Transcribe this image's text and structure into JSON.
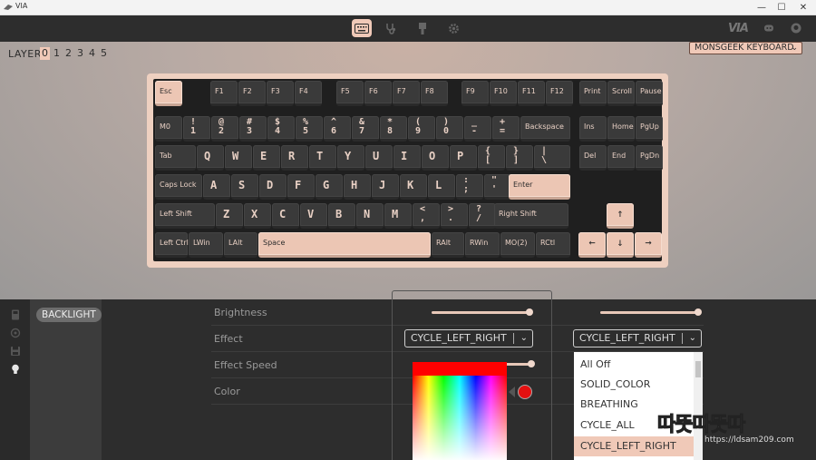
{
  "window": {
    "title": "VIA"
  },
  "layers": {
    "label": "LAYER",
    "items": [
      "0",
      "1",
      "2",
      "3",
      "4",
      "5"
    ],
    "active": 0
  },
  "keyboard_select": {
    "value": "MONSGEEK KEYBOARD"
  },
  "brand": "VIA",
  "keys": {
    "esc": "Esc",
    "f1": "F1",
    "f2": "F2",
    "f3": "F3",
    "f4": "F4",
    "f5": "F5",
    "f6": "F6",
    "f7": "F7",
    "f8": "F8",
    "f9": "F9",
    "f10": "F10",
    "f11": "F11",
    "f12": "F12",
    "print": "Print",
    "scroll": "Scroll",
    "pause": "Pause",
    "m0": "M0",
    "n1_top": "!",
    "n1_bot": "1",
    "n2_top": "@",
    "n2_bot": "2",
    "n3_top": "#",
    "n3_bot": "3",
    "n4_top": "$",
    "n4_bot": "4",
    "n5_top": "%",
    "n5_bot": "5",
    "n6_top": "^",
    "n6_bot": "6",
    "n7_top": "&",
    "n7_bot": "7",
    "n8_top": "*",
    "n8_bot": "8",
    "n9_top": "(",
    "n9_bot": "9",
    "n0_top": ")",
    "n0_bot": "0",
    "minus_top": "_",
    "minus_bot": "-",
    "eq_top": "+",
    "eq_bot": "=",
    "backspace": "Backspace",
    "ins": "Ins",
    "home": "Home",
    "pgup": "PgUp",
    "tab": "Tab",
    "q": "Q",
    "w": "W",
    "e": "E",
    "r": "R",
    "t": "T",
    "y": "Y",
    "u": "U",
    "i": "I",
    "o": "O",
    "p": "P",
    "lbr_top": "{",
    "lbr_bot": "[",
    "rbr_top": "}",
    "rbr_bot": "]",
    "bsl_top": "|",
    "bsl_bot": "\\",
    "del": "Del",
    "end": "End",
    "pgdn": "PgDn",
    "caps": "Caps Lock",
    "a": "A",
    "s": "S",
    "d": "D",
    "f": "F",
    "g": "G",
    "h": "H",
    "j": "J",
    "k": "K",
    "l": "L",
    "semi_top": ":",
    "semi_bot": ";",
    "quote_top": "\"",
    "quote_bot": "'",
    "enter": "Enter",
    "lshift": "Left Shift",
    "z": "Z",
    "x": "X",
    "c": "C",
    "v": "V",
    "b": "B",
    "n": "N",
    "m": "M",
    "comma_top": "<",
    "comma_bot": ",",
    "dot_top": ">",
    "dot_bot": ".",
    "slash_top": "?",
    "slash_bot": "/",
    "rshift": "Right Shift",
    "up": "↑",
    "lctrl": "Left Ctrl",
    "lwin": "LWin",
    "lalt": "LAlt",
    "space": "Space",
    "ralt": "RAlt",
    "rwin": "RWin",
    "mo2": "MO(2)",
    "rctl": "RCtl",
    "left": "←",
    "down": "↓",
    "right": "→"
  },
  "panel": {
    "menu_item": "BACKLIGHT",
    "rows": {
      "brightness": "Brightness",
      "effect": "Effect",
      "effect_speed": "Effect Speed",
      "color": "Color"
    },
    "brightness_value": 1.0,
    "brightness_value_right": 1.0,
    "effect_speed_value": 1.0,
    "effect_value": "CYCLE_LEFT_RIGHT",
    "effect_value_right": "CYCLE_LEFT_RIGHT",
    "color_value": "#e41010",
    "options": [
      "All Off",
      "SOLID_COLOR",
      "BREATHING",
      "CYCLE_ALL",
      "CYCLE_LEFT_RIGHT"
    ]
  },
  "watermark": {
    "main": "따뜻따뜻따",
    "url": "https://ldsam209.com"
  },
  "colors": {
    "accent": "#f0c9b8",
    "keycap_dark": "#3a3a3a",
    "panel_bg": "#2d2d2d"
  }
}
